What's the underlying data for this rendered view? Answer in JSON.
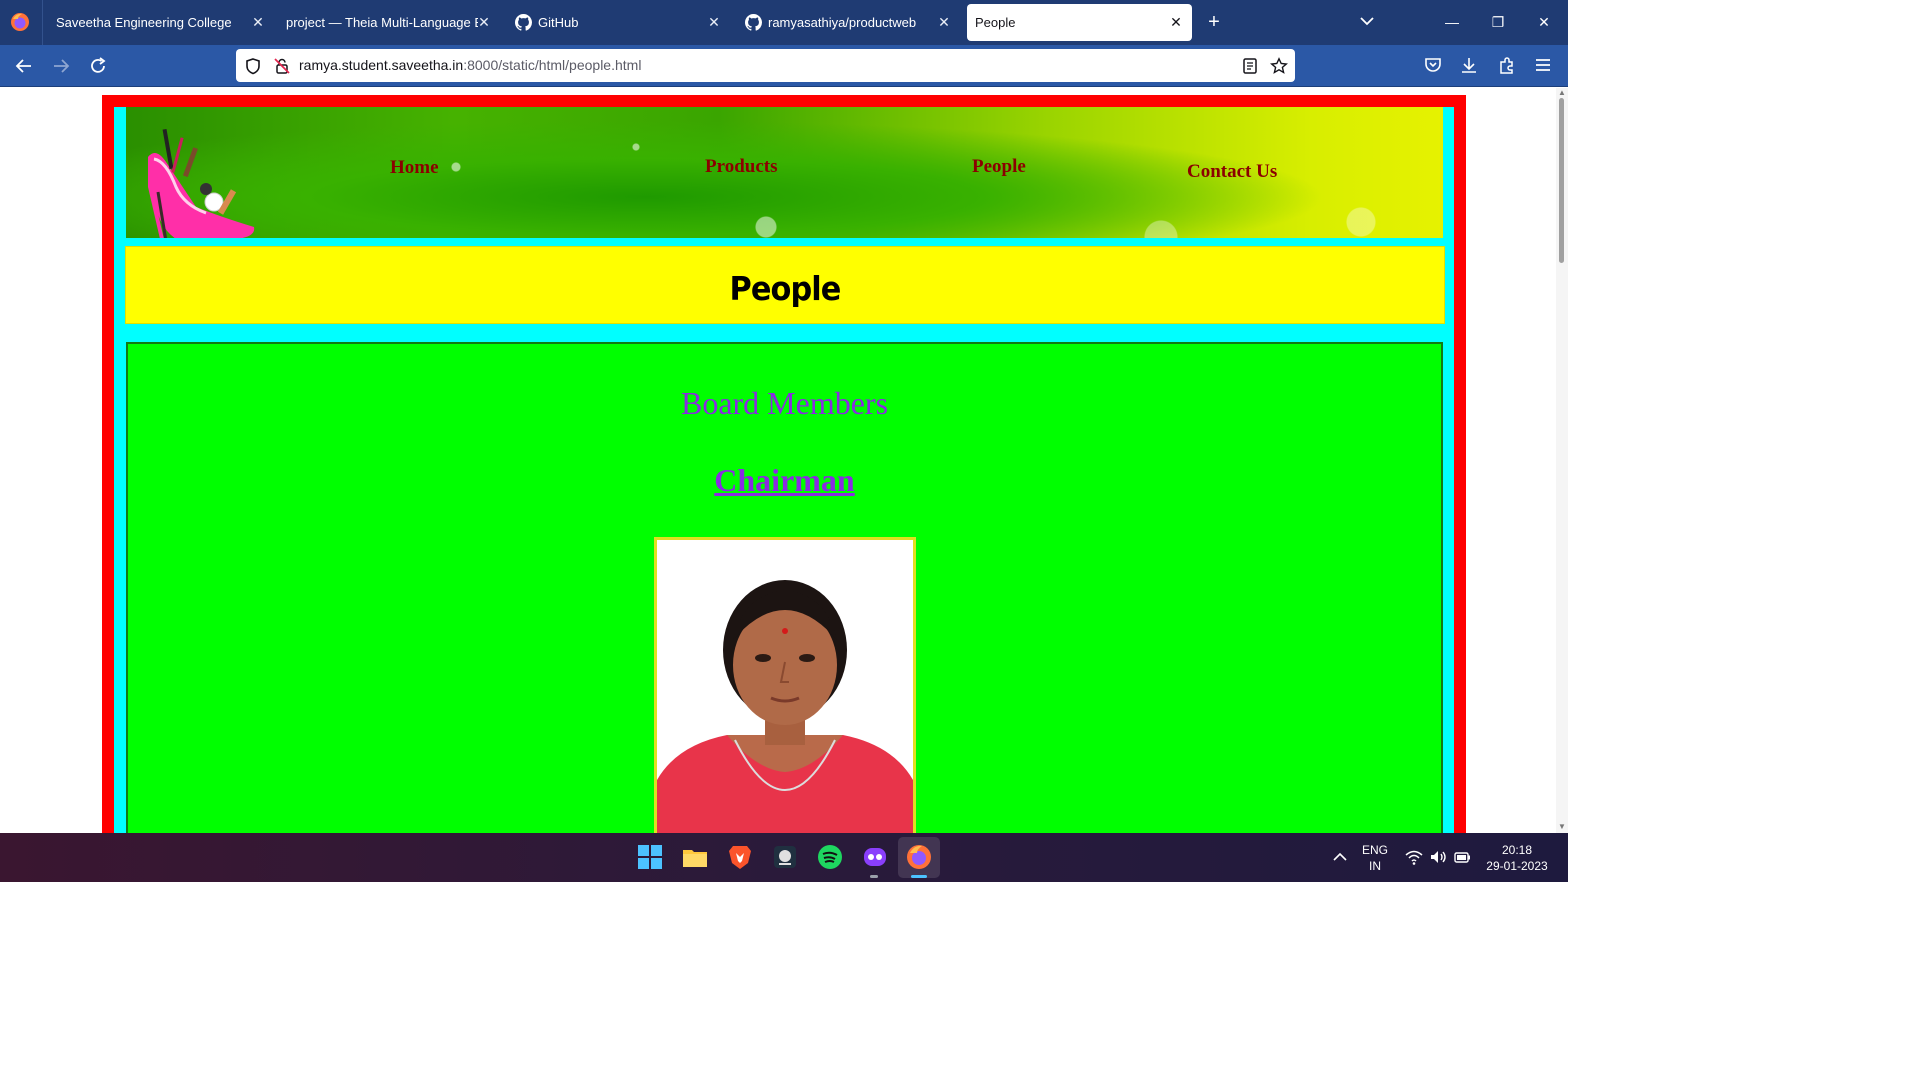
{
  "browser": {
    "tabs": [
      {
        "title": "Saveetha Engineering College",
        "active": false
      },
      {
        "title": "project — Theia Multi-Language Ex",
        "active": false
      },
      {
        "title": "GitHub",
        "active": false
      },
      {
        "title": "ramyasathiya/productweb",
        "active": false
      },
      {
        "title": "People",
        "active": true
      }
    ],
    "url_host": "ramya.student.saveetha.in",
    "url_rest": ":8000/static/html/people.html"
  },
  "page": {
    "nav": {
      "home": "Home",
      "products": "Products",
      "people": "People",
      "contact": "Contact Us"
    },
    "title": "People",
    "board_heading": "Board Members",
    "chairman": "Chairman"
  },
  "taskbar": {
    "language": "ENG",
    "region": "IN",
    "time": "20:18",
    "date": "29-01-2023"
  },
  "colors": {
    "frame_red": "#ff0000",
    "frame_cyan": "#00ffff",
    "title_yellow": "#ffff00",
    "content_green": "#00ff00",
    "nav_link": "#8b0000",
    "heading_purple": "#8a2be2"
  }
}
